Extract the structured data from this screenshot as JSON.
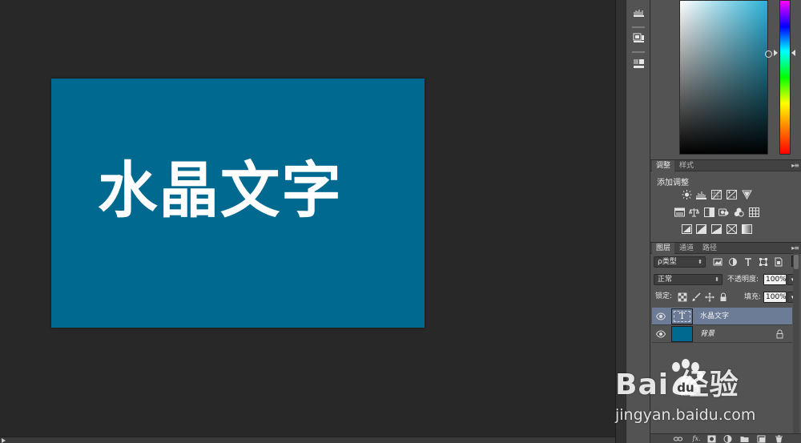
{
  "canvas": {
    "text": "水晶文字",
    "bg_color": "#00698f",
    "text_color": "#ffffff"
  },
  "adjustments_panel": {
    "tabs": [
      "调整",
      "样式"
    ],
    "title": "添加调整"
  },
  "layers_panel": {
    "tabs": [
      "图层",
      "通道",
      "路径"
    ],
    "filter_kind": "ρ类型",
    "blend_mode": "正常",
    "opacity_label": "不透明度:",
    "opacity_value": "100%",
    "lock_label": "锁定:",
    "fill_label": "填充:",
    "fill_value": "100%",
    "layers": [
      {
        "name": "水晶文字",
        "type": "text",
        "thumb_glyph": "T",
        "selected": true
      },
      {
        "name": "背景",
        "type": "background",
        "locked": true,
        "selected": false
      }
    ]
  },
  "watermark": {
    "main": "Bai  经验",
    "sub": "jingyan.baidu.com"
  },
  "colors": {
    "workspace": "#282828",
    "panel": "#535353",
    "selection": "#6c7b96"
  }
}
